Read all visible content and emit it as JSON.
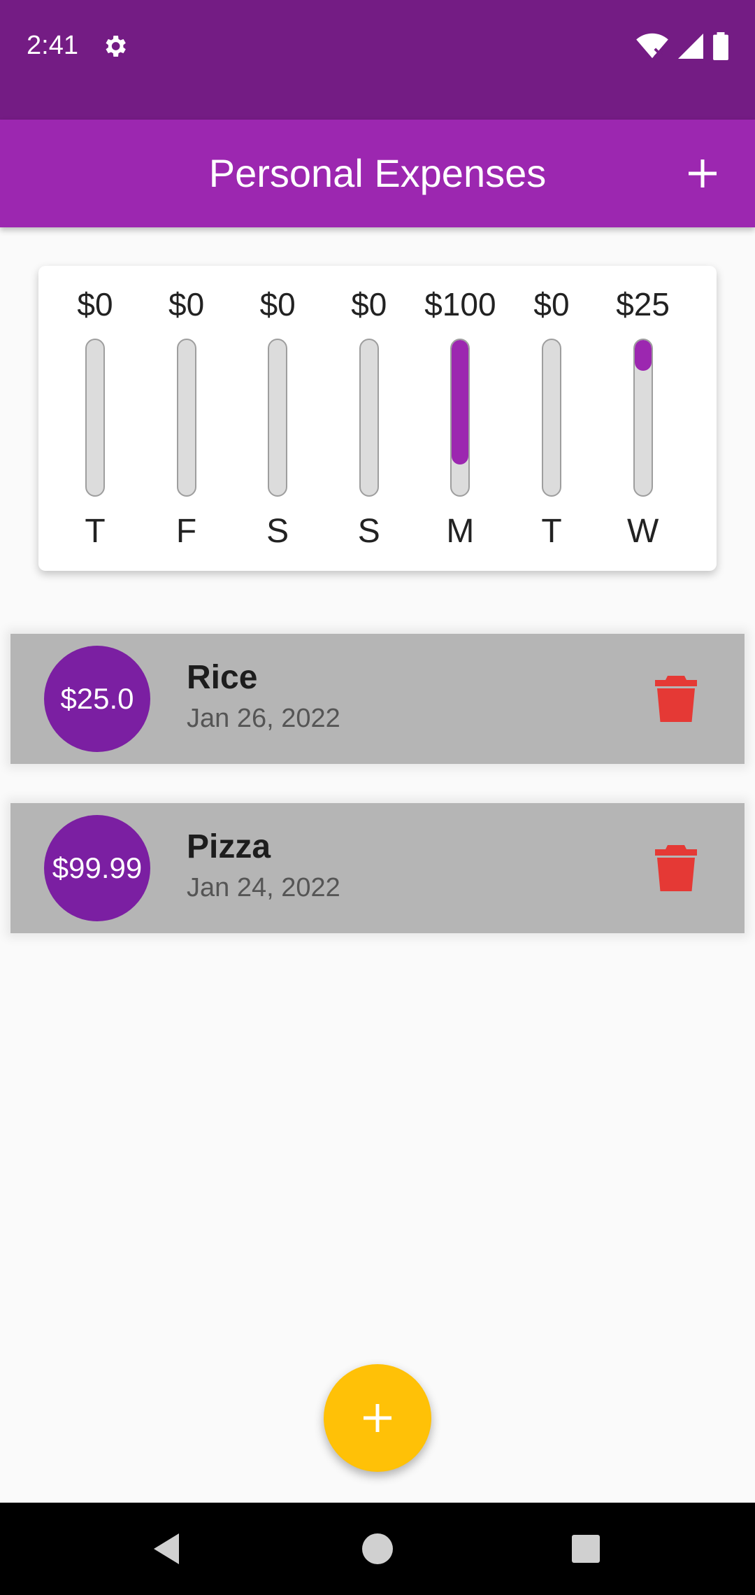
{
  "status_bar": {
    "time": "2:41",
    "icons": [
      "gear-icon",
      "wifi-off-icon",
      "signal-icon",
      "battery-icon"
    ]
  },
  "app_bar": {
    "title": "Personal Expenses",
    "add_icon": "plus-icon",
    "color": "#9c27b0",
    "status_color": "#741c84"
  },
  "chart_data": {
    "type": "bar",
    "categories": [
      "T",
      "F",
      "S",
      "S",
      "M",
      "T",
      "W"
    ],
    "value_labels": [
      "$0",
      "$0",
      "$0",
      "$0",
      "$100",
      "$0",
      "$25"
    ],
    "values": [
      0,
      0,
      0,
      0,
      100,
      0,
      25
    ],
    "fill_fractions": [
      0,
      0,
      0,
      0,
      0.8,
      0,
      0.2
    ],
    "ylim": [
      0,
      124.99
    ],
    "bar_color": "#9c27b0",
    "track_color": "#dcdcdc"
  },
  "transactions": [
    {
      "amount": "$25.0",
      "title": "Rice",
      "date": "Jan 26, 2022",
      "delete_icon": "trash-icon"
    },
    {
      "amount": "$99.99",
      "title": "Pizza",
      "date": "Jan 24, 2022",
      "delete_icon": "trash-icon"
    }
  ],
  "fab": {
    "icon": "plus-icon",
    "color": "#ffc107"
  },
  "nav_bar": {
    "icons": [
      "back-triangle-icon",
      "home-circle-icon",
      "recents-square-icon"
    ]
  }
}
